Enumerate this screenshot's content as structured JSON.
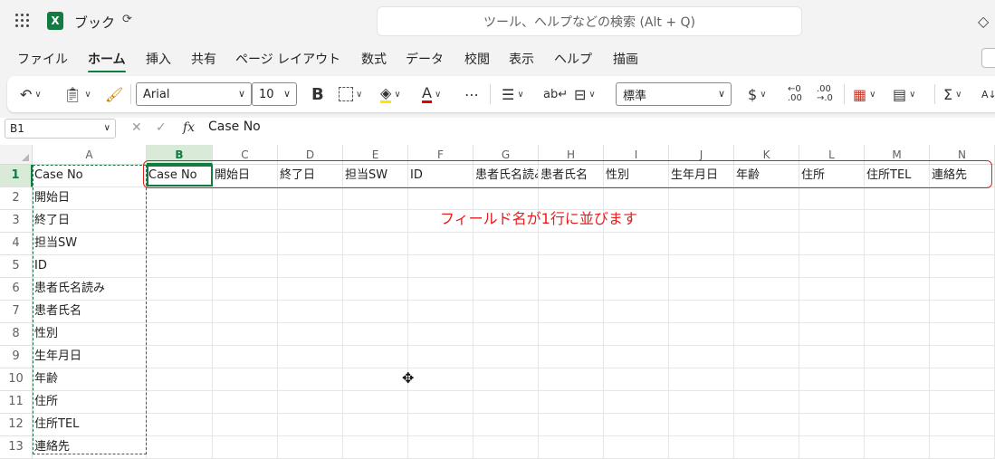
{
  "title": {
    "app": "ブック",
    "search_placeholder": "ツール、ヘルプなどの検索 (Alt + Q)"
  },
  "tabs": [
    "ファイル",
    "ホーム",
    "挿入",
    "共有",
    "ページ レイアウト",
    "数式",
    "データ",
    "校閲",
    "表示",
    "ヘルプ",
    "描画"
  ],
  "active_tab": "ホーム",
  "ribbon": {
    "font": "Arial",
    "size": "10",
    "number_format": "標準",
    "bold": "B",
    "currency": "$"
  },
  "formula_bar": {
    "name_box": "B1",
    "fx": "fx",
    "value": "Case No"
  },
  "columns": [
    "A",
    "B",
    "C",
    "D",
    "E",
    "F",
    "G",
    "H",
    "I",
    "J",
    "K",
    "L",
    "M",
    "N"
  ],
  "rows": [
    "1",
    "2",
    "3",
    "4",
    "5",
    "6",
    "7",
    "8",
    "9",
    "10",
    "11",
    "12",
    "13"
  ],
  "column_a": [
    "Case No",
    "開始日",
    "終了日",
    "担当SW",
    "ID",
    "患者氏名読み",
    "患者氏名",
    "性別",
    "生年月日",
    "年齢",
    "住所",
    "住所TEL",
    "連絡先"
  ],
  "row1": [
    "Case No",
    "開始日",
    "終了日",
    "担当SW",
    "ID",
    "患者氏名読み",
    "患者氏名",
    "性別",
    "生年月日",
    "年齢",
    "住所",
    "住所TEL",
    "連絡先"
  ],
  "annotation": "フィールド名が1行に並びます",
  "colors": {
    "accent": "#107c41",
    "annotation": "#e81c1c"
  }
}
